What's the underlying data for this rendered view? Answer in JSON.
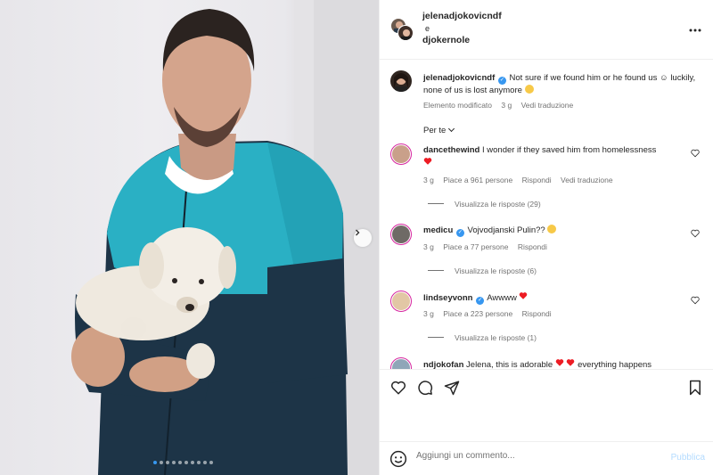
{
  "post": {
    "slide_count": 10,
    "active_slide": 0
  },
  "header": {
    "author": "jelenadjokovicndf",
    "separator": "e",
    "coauthor": "djokernole",
    "more_icon": "more-horizontal-icon"
  },
  "caption": {
    "username": "jelenadjokovicndf",
    "text": "Not sure if we found him or he found us ☺ luckily, none of us is lost anymore",
    "edited": "Elemento modificato",
    "time": "3 g",
    "translate": "Vedi traduzione"
  },
  "sort_label": "Per te",
  "comments": [
    {
      "username": "dancethewind",
      "verified": false,
      "text": "I wonder if they saved him from homelessness",
      "time": "3 g",
      "likes": "Piace a 961 persone",
      "reply": "Rispondi",
      "translate": "Vedi traduzione",
      "replies": "Visualizza le risposte (29)"
    },
    {
      "username": "medicu",
      "verified": true,
      "text": "Vojvodjanski Pulin??",
      "time": "3 g",
      "likes": "Piace a 77 persone",
      "reply": "Rispondi",
      "replies": "Visualizza le risposte (6)"
    },
    {
      "username": "lindseyvonn",
      "verified": true,
      "text": "Awwww",
      "time": "3 g",
      "likes": "Piace a 223 persone",
      "reply": "Rispondi",
      "replies": "Visualizza le risposte (1)"
    },
    {
      "username": "ndjokofan",
      "verified": false,
      "text": "Jelena, this is adorable",
      "text_tail": "everything happens"
    }
  ],
  "compose": {
    "placeholder": "Aggiungi un commento...",
    "publish": "Pubblica"
  },
  "colors": {
    "accent": "#3797f0",
    "heart": "#ed1c24",
    "publish_disabled": "#b3dbff"
  }
}
